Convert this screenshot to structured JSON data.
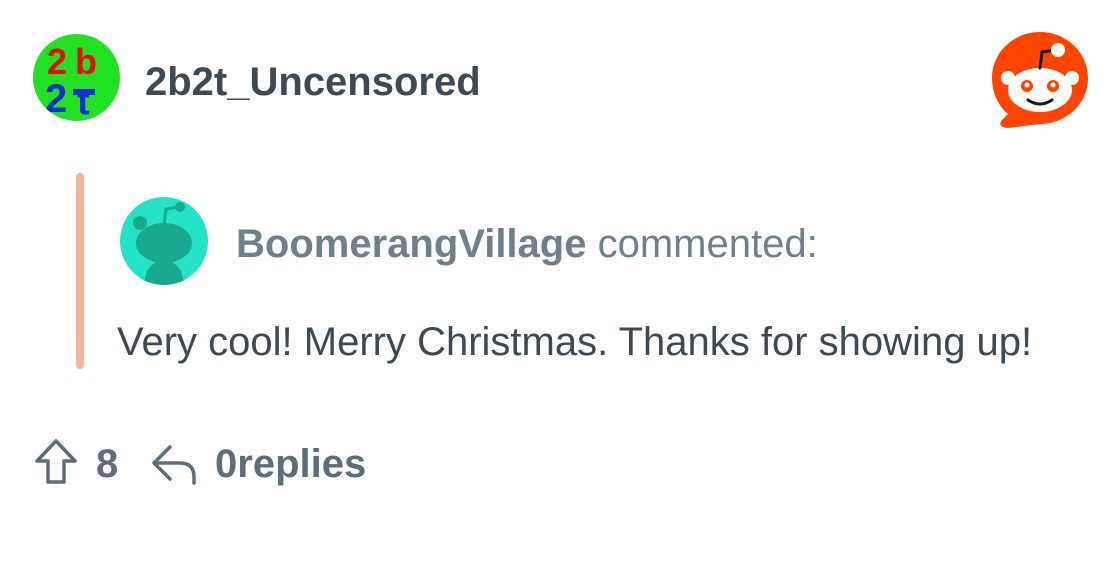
{
  "post": {
    "author": "2b2t_Uncensored",
    "avatar_icon": "2b2t-logo-avatar",
    "brand_icon": "reddit-snoo-logo",
    "brand_color": "#ff4500"
  },
  "quoted_comment": {
    "author": "BoomerangVillage",
    "action": "commented:",
    "body": "Very cool! Merry Christmas. Thanks for showing up!",
    "avatar_icon": "default-snoo-avatar",
    "accent_color": "#f5b39a"
  },
  "footer": {
    "score": "8",
    "replies_count": "0",
    "replies_label": "replies",
    "upvote_icon": "upvote-arrow-icon",
    "reply_icon": "reply-arrow-icon"
  }
}
